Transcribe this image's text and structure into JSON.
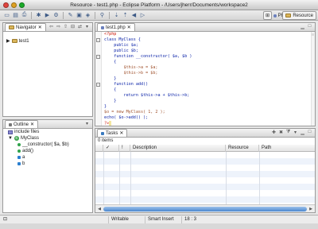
{
  "window": {
    "title": "Resource - test1.php - Eclipse Platform - /Users/jherr/Documents/workspace2"
  },
  "perspectives": {
    "php": "PHP",
    "resource": "Resource"
  },
  "navigator": {
    "title": "Navigator",
    "items": [
      "test1"
    ]
  },
  "editor": {
    "tab": "test1.php",
    "lines": [
      "<?php",
      "class MyClass {",
      "    public $a;",
      "    public $b;",
      "    function __constructor( $a, $b )",
      "    {",
      "        $this->a = $a;",
      "        $this->b = $b;",
      "    }",
      "    function add()",
      "    {",
      "        return $this->a + $this->b;",
      "    }",
      "}",
      "$o = new MyClass( 1, 2 );",
      "echo( $o->add() );",
      "?>"
    ]
  },
  "outline": {
    "title": "Outline",
    "items": [
      {
        "label": "include files",
        "icon": "include-icon",
        "level": 0
      },
      {
        "label": "MyClass",
        "icon": "class-icon",
        "level": 0
      },
      {
        "label": "__constructor( $a, $b)",
        "icon": "method-icon",
        "level": 1
      },
      {
        "label": "add()",
        "icon": "method-icon",
        "level": 1
      },
      {
        "label": "a",
        "icon": "field-icon",
        "level": 1
      },
      {
        "label": "b",
        "icon": "field-icon",
        "level": 1
      }
    ]
  },
  "tasks": {
    "title": "Tasks",
    "count": "0 items",
    "columns": [
      "✓",
      "!",
      "Description",
      "Resource",
      "Path"
    ]
  },
  "status": {
    "mode": "Writable",
    "insert": "Smart Insert",
    "position": "18 : 3"
  },
  "colors": {
    "keyword": "#0a22a8",
    "variable": "#a0522d",
    "number": "#cc0000",
    "selection": "#4b87cf"
  }
}
